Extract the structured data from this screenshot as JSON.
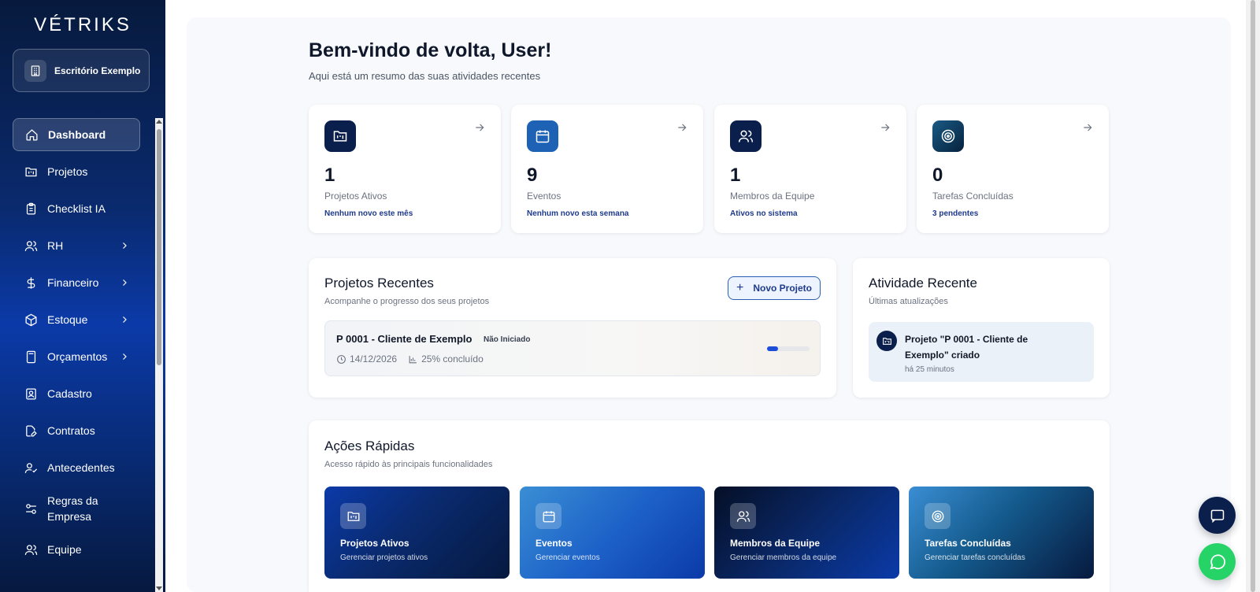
{
  "app": {
    "logo": "VÉTRIKS"
  },
  "sidebar": {
    "office": "Escritório Exemplo",
    "items": [
      {
        "label": "Dashboard",
        "icon": "home-icon"
      },
      {
        "label": "Projetos",
        "icon": "folder-kanban-icon"
      },
      {
        "label": "Checklist IA",
        "icon": "clipboard-icon"
      },
      {
        "label": "RH",
        "icon": "users-icon"
      },
      {
        "label": "Financeiro",
        "icon": "dollar-icon"
      },
      {
        "label": "Estoque",
        "icon": "box-icon"
      },
      {
        "label": "Orçamentos",
        "icon": "calculator-icon"
      },
      {
        "label": "Cadastro",
        "icon": "id-card-icon"
      },
      {
        "label": "Contratos",
        "icon": "file-edit-icon"
      },
      {
        "label": "Antecedentes",
        "icon": "user-check-icon"
      },
      {
        "label": "Regras da Empresa",
        "icon": "sliders-icon"
      },
      {
        "label": "Equipe",
        "icon": "team-icon"
      }
    ]
  },
  "header": {
    "title": "Bem-vindo de volta, User!",
    "subtitle": "Aqui está um resumo das suas atividades recentes"
  },
  "stats": [
    {
      "value": "1",
      "label": "Projetos Ativos",
      "note": "Nenhum novo este mês",
      "icon": "folder-kanban-icon",
      "color": "#0b1f4d"
    },
    {
      "value": "9",
      "label": "Eventos",
      "note": "Nenhum novo esta semana",
      "icon": "calendar-icon",
      "color": "#1d62b5"
    },
    {
      "value": "1",
      "label": "Membros da Equipe",
      "note": "Ativos no sistema",
      "icon": "users-icon",
      "color": "#0b1f4d"
    },
    {
      "value": "0",
      "label": "Tarefas Concluídas",
      "note": "3 pendentes",
      "icon": "target-icon",
      "color": "#0f3d5e"
    }
  ],
  "recent_projects": {
    "title": "Projetos Recentes",
    "subtitle": "Acompanhe o progresso dos seus projetos",
    "new_button": "Novo Projeto",
    "items": [
      {
        "name": "P 0001 - Cliente de Exemplo",
        "status": "Não Iniciado",
        "date": "14/12/2026",
        "progress_text": "25% concluído",
        "progress": 0.25
      }
    ]
  },
  "activity": {
    "title": "Atividade Recente",
    "subtitle": "Últimas atualizações",
    "items": [
      {
        "text": "Projeto \"P 0001 - Cliente de Exemplo\" criado",
        "time": "há 25 minutos"
      }
    ]
  },
  "quick_actions": {
    "title": "Ações Rápidas",
    "subtitle": "Acesso rápido às principais funcionalidades",
    "items": [
      {
        "title": "Projetos Ativos",
        "subtitle": "Gerenciar projetos ativos",
        "icon": "folder-kanban-icon"
      },
      {
        "title": "Eventos",
        "subtitle": "Gerenciar eventos",
        "icon": "calendar-icon"
      },
      {
        "title": "Membros da Equipe",
        "subtitle": "Gerenciar membros da equipe",
        "icon": "users-icon"
      },
      {
        "title": "Tarefas Concluídas",
        "subtitle": "Gerenciar tarefas concluídas",
        "icon": "target-icon"
      }
    ]
  },
  "fab": {
    "chat_icon": "chat-icon",
    "whatsapp_icon": "whatsapp-icon",
    "whatsapp_color": "#25d366"
  }
}
